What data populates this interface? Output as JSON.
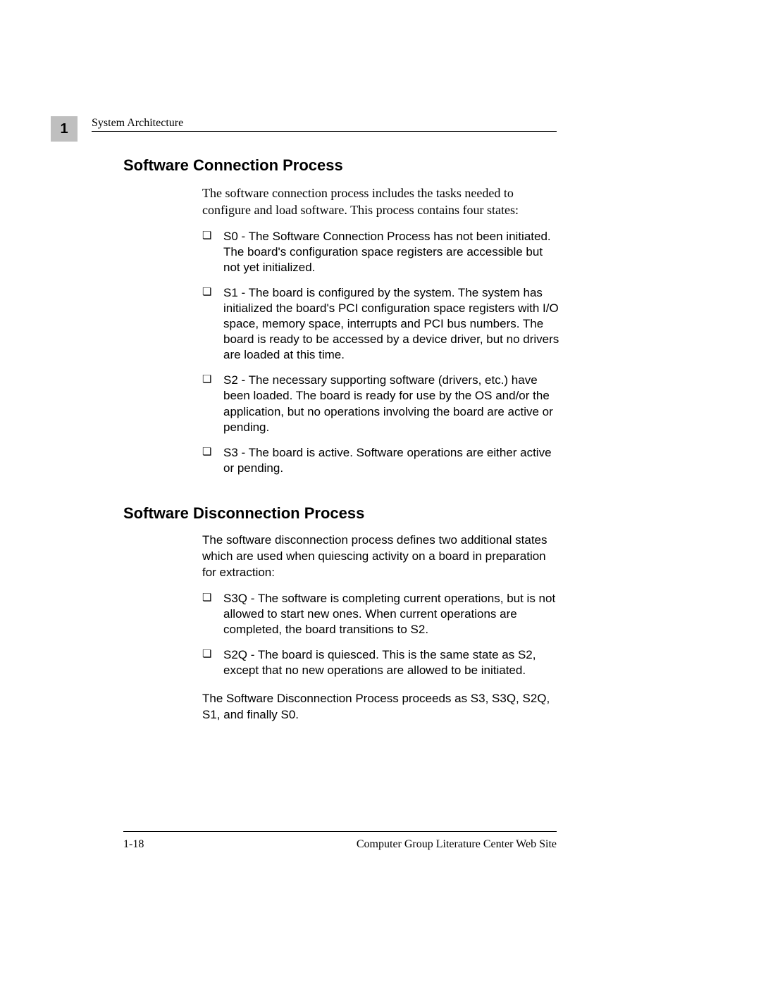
{
  "chapter_number": "1",
  "running_header": "System Architecture",
  "section1": {
    "title": "Software Connection Process",
    "intro": "The software connection process includes the tasks needed to configure and load software. This process contains four states:",
    "items": [
      "S0 - The Software Connection Process has not been initiated. The board's configuration space registers are accessible but not yet initialized.",
      "S1 - The board is configured by the system. The system has initialized the board's PCI configuration space registers with I/O space, memory space, interrupts and PCI bus numbers. The board is ready to be accessed by a device driver, but no drivers are loaded at this time.",
      "S2 - The necessary supporting software (drivers, etc.) have been loaded. The board is ready for use by the OS and/or the application, but no operations involving the board are active or pending.",
      "S3 - The board is active. Software operations are either active or pending."
    ]
  },
  "section2": {
    "title": "Software Disconnection Process",
    "intro": "The software disconnection process defines two additional states which are used when quiescing activity on a board in preparation for extraction:",
    "items": [
      "S3Q - The software is completing current operations, but is not allowed to start new ones. When current operations are completed, the board transitions to S2.",
      "S2Q - The board is quiesced. This is the same state as S2, except that no new operations are allowed to be initiated."
    ],
    "outro": "The Software Disconnection Process proceeds as S3, S3Q, S2Q, S1, and finally S0."
  },
  "footer": {
    "page_number": "1-18",
    "right": "Computer Group Literature Center Web Site"
  }
}
